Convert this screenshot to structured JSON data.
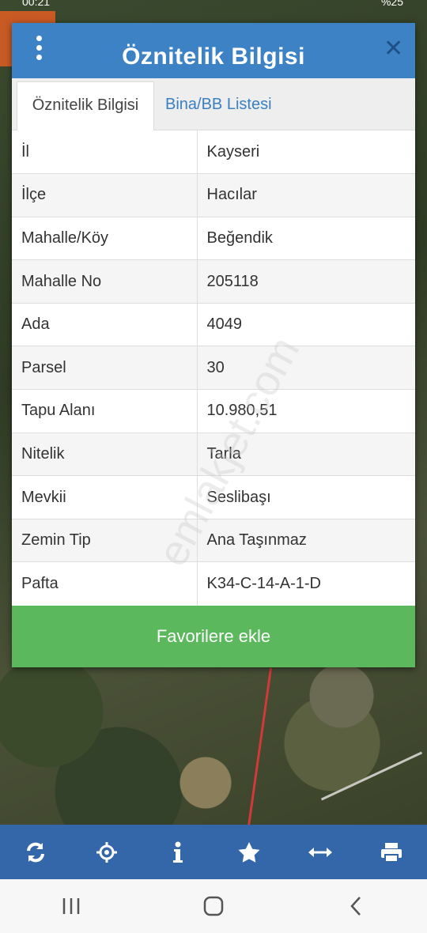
{
  "status_bar": {
    "time": "00:21",
    "right": "%25"
  },
  "dialog": {
    "title": "Öznitelik Bilgisi",
    "close_icon": "close-icon",
    "menu_icon": "kebab-menu-icon"
  },
  "tabs": [
    {
      "label": "Öznitelik Bilgisi",
      "active": true
    },
    {
      "label": "Bina/BB Listesi",
      "active": false
    }
  ],
  "attributes": [
    {
      "key": "İl",
      "value": "Kayseri"
    },
    {
      "key": "İlçe",
      "value": "Hacılar"
    },
    {
      "key": "Mahalle/Köy",
      "value": "Beğendik"
    },
    {
      "key": "Mahalle No",
      "value": "205118"
    },
    {
      "key": "Ada",
      "value": "4049"
    },
    {
      "key": "Parsel",
      "value": "30"
    },
    {
      "key": "Tapu Alanı",
      "value": "10.980,51"
    },
    {
      "key": "Nitelik",
      "value": "Tarla"
    },
    {
      "key": "Mevkii",
      "value": "Seslibaşı"
    },
    {
      "key": "Zemin Tip",
      "value": "Ana Taşınmaz"
    },
    {
      "key": "Pafta",
      "value": "K34-C-14-A-1-D"
    }
  ],
  "favorite_button": "Favorilere ekle",
  "watermark": "emlakjet.com",
  "toolbar_icons": [
    "refresh-icon",
    "locate-icon",
    "info-icon",
    "star-icon",
    "measure-icon",
    "print-icon"
  ],
  "nav_icons": [
    "recents-icon",
    "home-icon",
    "back-icon"
  ],
  "colors": {
    "header": "#3d82c4",
    "button": "#5cb85c",
    "toolbar": "#3467a9",
    "tab_link": "#3a7fc1"
  }
}
